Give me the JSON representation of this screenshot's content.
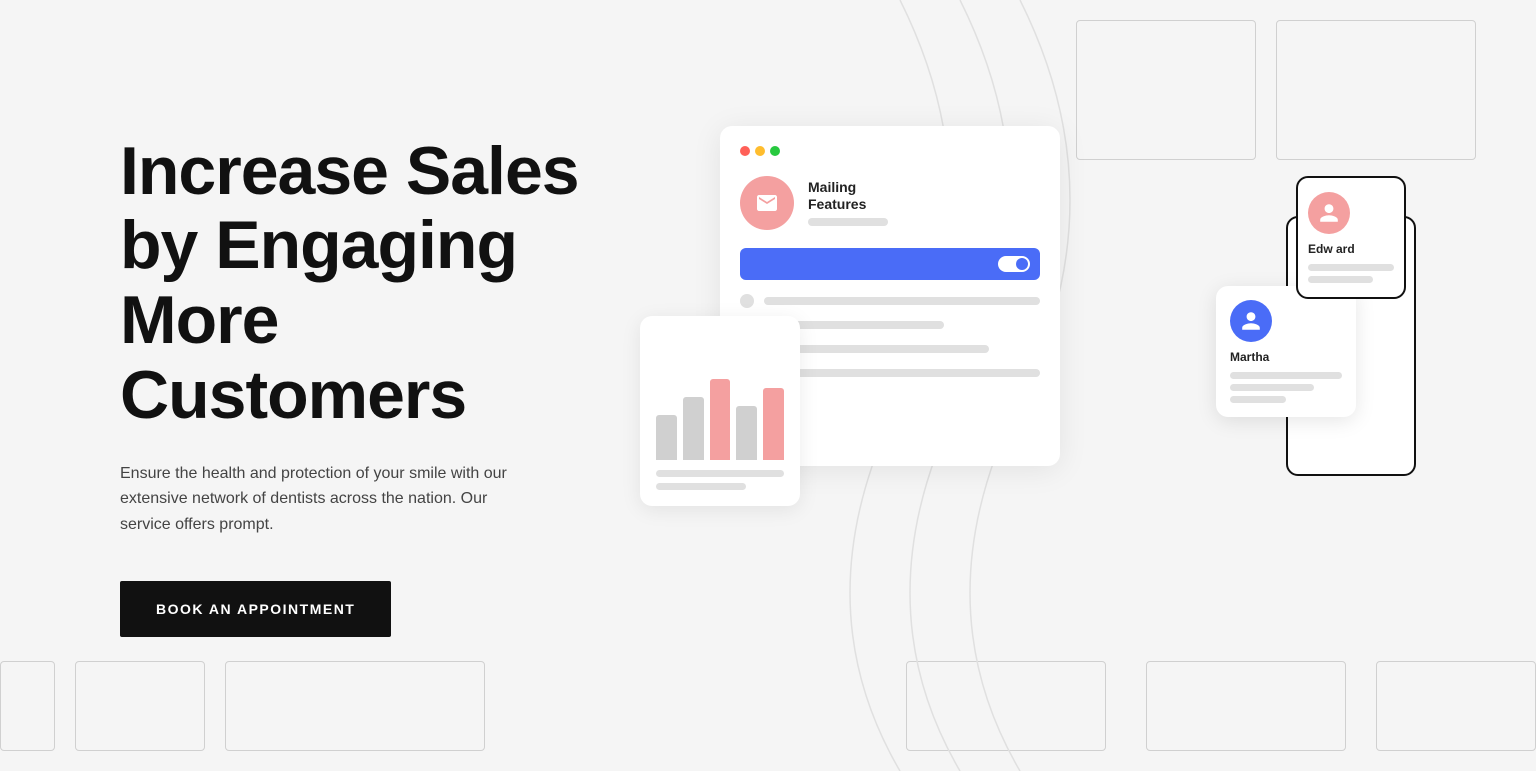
{
  "hero": {
    "title": "Increase Sales by Engaging More Customers",
    "subtitle": "Ensure the health and protection of your smile with our extensive network of dentists across the nation. Our service offers prompt.",
    "cta_label": "Book An Appointment"
  },
  "ui_illustration": {
    "card_main": {
      "feature_label": "Mailing",
      "feature_sub": "Features"
    },
    "user_martha": {
      "name": "Martha"
    },
    "user_edward": {
      "name": "Edw ard"
    }
  },
  "dots": {
    "red": "#ff6058",
    "yellow": "#ffbd2e",
    "green": "#27c93f"
  }
}
